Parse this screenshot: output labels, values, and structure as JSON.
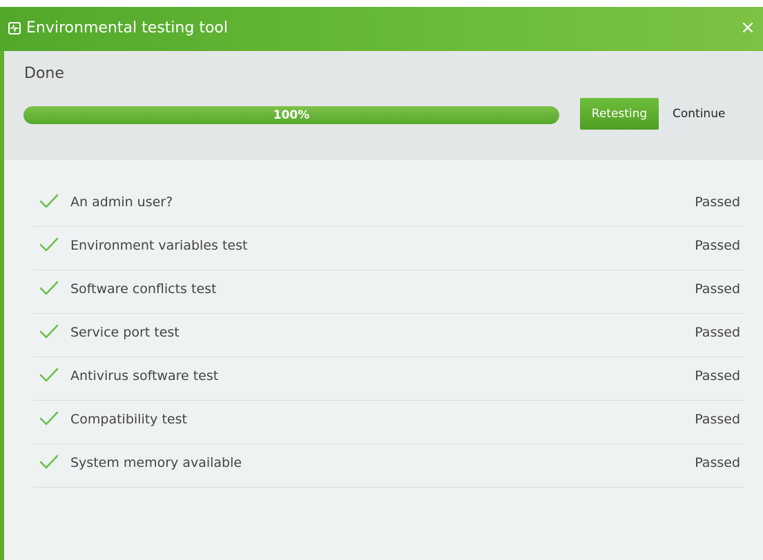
{
  "window": {
    "title": "Environmental testing tool",
    "close_glyph": "×",
    "app_icon": "activity-monitor-icon"
  },
  "status": {
    "text": "Done",
    "progress_value": 100,
    "progress_label": "100%"
  },
  "buttons": {
    "retest_label": "Retesting",
    "continue_label": "Continue"
  },
  "checks": [
    {
      "label": "An admin user?",
      "status": "Passed"
    },
    {
      "label": "Environment variables test",
      "status": "Passed"
    },
    {
      "label": "Software conflicts test",
      "status": "Passed"
    },
    {
      "label": "Service port test",
      "status": "Passed"
    },
    {
      "label": "Antivirus software test",
      "status": "Passed"
    },
    {
      "label": "Compatibility test",
      "status": "Passed"
    },
    {
      "label": "System memory available",
      "status": "Passed"
    }
  ],
  "colors": {
    "accent": "#5fae2c",
    "check": "#6cc04a"
  }
}
